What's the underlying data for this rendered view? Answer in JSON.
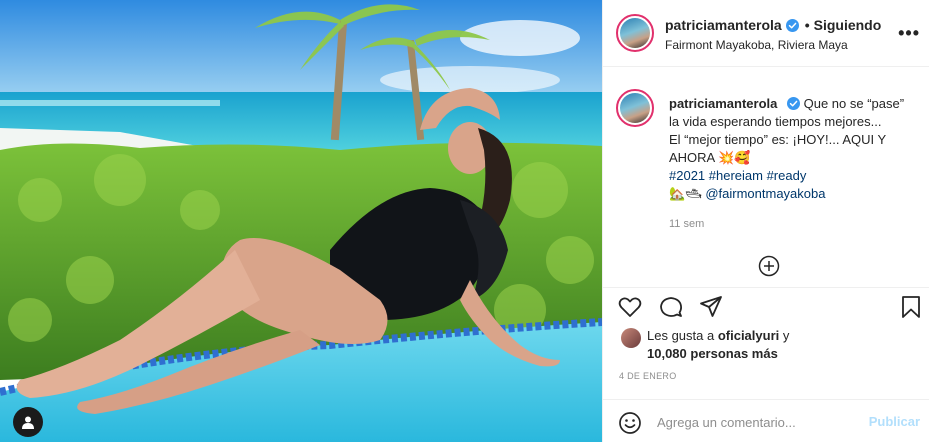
{
  "post": {
    "username": "patriciamanterola",
    "following_label": "Siguiendo",
    "location": "Fairmont Mayakoba, Riviera Maya",
    "more_label": "•••"
  },
  "caption": {
    "username": "patriciamanterola",
    "line1": "Que no se “pase”",
    "line2": "la vida esperando tiempos mejores...",
    "line3": "El “mejor tiempo” es: ¡HOY!... AQUI Y",
    "line4": "AHORA 💥🥰",
    "hashtags": "#2021 #hereiam #ready",
    "mention_prefix": "🏡🛥",
    "mention": "@fairmontmayakoba",
    "time": "11 sem"
  },
  "likes": {
    "prefix": "Les gusta a ",
    "user": "oficialyuri",
    "middle": " y",
    "count": "10,080 personas más"
  },
  "date": "4 DE ENERO",
  "comment": {
    "placeholder": "Agrega un comentario...",
    "publish_label": "Publicar"
  },
  "icons": {
    "like": "heart-icon",
    "comment": "comment-bubble-icon",
    "share": "paper-plane-icon",
    "save": "bookmark-icon",
    "emoji": "smiley-icon",
    "add": "circle-plus-icon",
    "verified": "verified-badge-icon",
    "profile": "user-icon"
  },
  "colors": {
    "verified": "#3897f0",
    "link": "#00376b",
    "muted": "#8e8e8e",
    "publish_disabled": "#b2dffc",
    "story_ring": "#e1306c"
  }
}
